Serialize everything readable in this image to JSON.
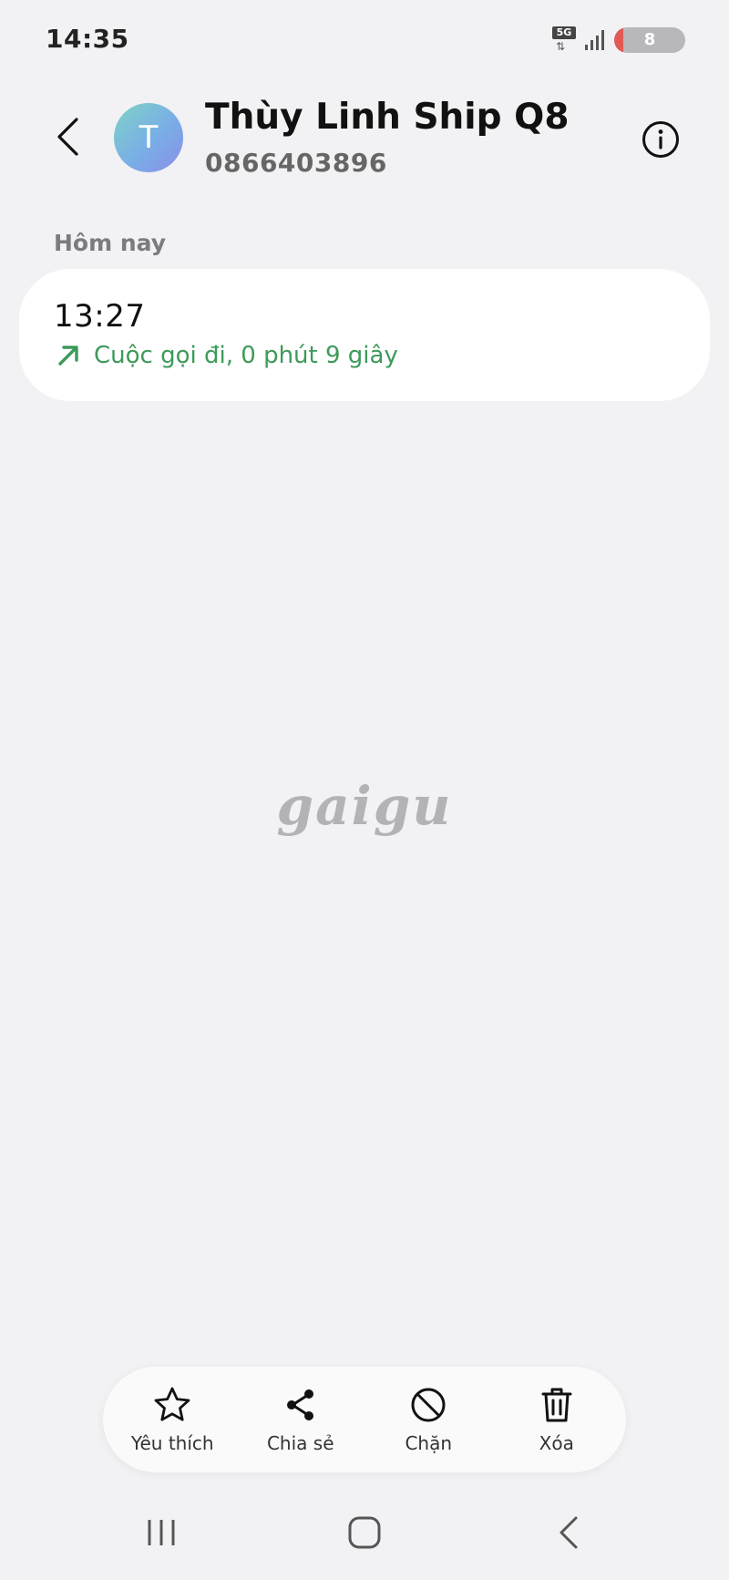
{
  "status_bar": {
    "time": "14:35",
    "network": "5G",
    "network_arrows": "⇅",
    "battery_level": "8",
    "battery_percent": 8
  },
  "header": {
    "contact_initial": "T",
    "contact_name": "Thùy Linh Ship Q8",
    "contact_number": "0866403896"
  },
  "call_log": {
    "section_label": "Hôm nay",
    "entries": [
      {
        "time": "13:27",
        "detail": "Cuộc gọi đi, 0 phút 9 giây",
        "type": "outgoing"
      }
    ]
  },
  "watermark": "gaigu",
  "actions": [
    {
      "label": "Yêu thích",
      "icon": "star-icon"
    },
    {
      "label": "Chia sẻ",
      "icon": "share-icon"
    },
    {
      "label": "Chặn",
      "icon": "block-icon"
    },
    {
      "label": "Xóa",
      "icon": "trash-icon"
    }
  ],
  "nav_bar": {
    "buttons": [
      "recent-apps-icon",
      "home-icon",
      "back-icon"
    ]
  },
  "colors": {
    "background": "#f2f2f4",
    "card": "#ffffff",
    "outgoing_call": "#3d9a5a",
    "battery_low": "#e15a55"
  }
}
